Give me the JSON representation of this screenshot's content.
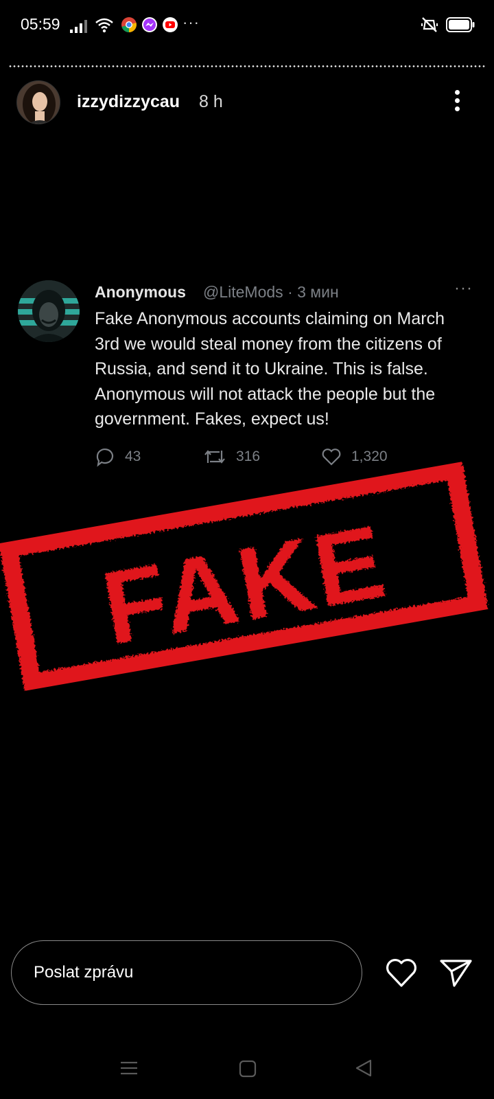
{
  "status_bar": {
    "time": "05:59",
    "overflow": "···",
    "icons": [
      "signal-icon",
      "wifi-icon",
      "chrome-icon",
      "messenger-icon",
      "youtube-icon",
      "mute-vibrate-icon",
      "battery-icon"
    ]
  },
  "story": {
    "progress_fraction": 1.0,
    "username": "izzydizzycau",
    "time_ago": "8 h",
    "menu_icon": "more-vertical-icon"
  },
  "tweet": {
    "name": "Anonymous",
    "handle": "@LiteMods · 3 мин",
    "more": "···",
    "lines": [
      "Fake Anonymous accounts claiming on March",
      "3rd we would steal money from the citizens of",
      "Russia, and send it to Ukraine. This is false.",
      "Anonymous will not attack the people but the",
      "government. Fakes, expect us!"
    ],
    "replies": "43",
    "retweets": "316",
    "likes": "1,320"
  },
  "stamp": {
    "text": "FAKE",
    "color": "#e0141c"
  },
  "message_bar": {
    "placeholder": "Poslat zprávu",
    "like_icon": "heart-icon",
    "send_icon": "send-icon"
  },
  "nav_bar": {
    "icons": [
      "menu-icon",
      "home-icon",
      "back-icon"
    ]
  },
  "colors": {
    "background": "#000000",
    "canvas_top": "#0b0b0d",
    "canvas_bottom": "#1c1c1c",
    "stamp_red": "#e0141c",
    "tweet_muted": "#7c8086"
  }
}
